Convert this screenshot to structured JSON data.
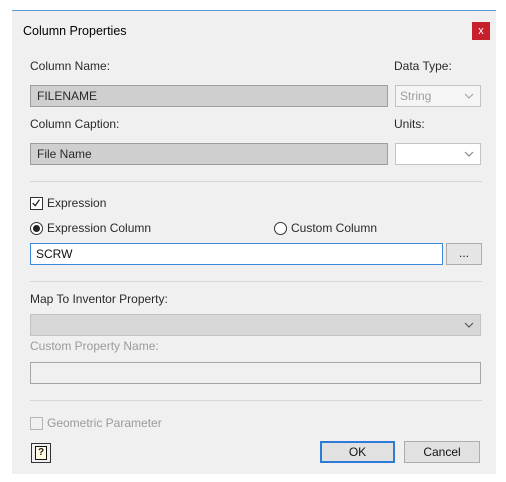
{
  "window": {
    "title": "Column Properties",
    "close_glyph": "x"
  },
  "column": {
    "name_label": "Column Name:",
    "name_value": "FILENAME",
    "caption_label": "Column Caption:",
    "caption_value": "File Name",
    "data_type_label": "Data Type:",
    "data_type_value": "String",
    "units_label": "Units:",
    "units_value": ""
  },
  "expression": {
    "checkbox_label": "Expression",
    "checked": true,
    "radio_expression_label": "Expression Column",
    "radio_custom_label": "Custom Column",
    "selected": "Expression Column",
    "value": "SCRW",
    "browse_label": "..."
  },
  "mapping": {
    "label": "Map To Inventor Property:",
    "selected_value": "",
    "custom_property_label": "Custom Property Name:",
    "custom_property_value": ""
  },
  "geometric": {
    "label": "Geometric Parameter",
    "checked": false,
    "enabled": false
  },
  "footer": {
    "help_glyph": "?",
    "ok_label": "OK",
    "cancel_label": "Cancel"
  },
  "colors": {
    "accent": "#2d7bd6",
    "close": "#c8202a",
    "dialog_bg": "#f0f0f0"
  }
}
